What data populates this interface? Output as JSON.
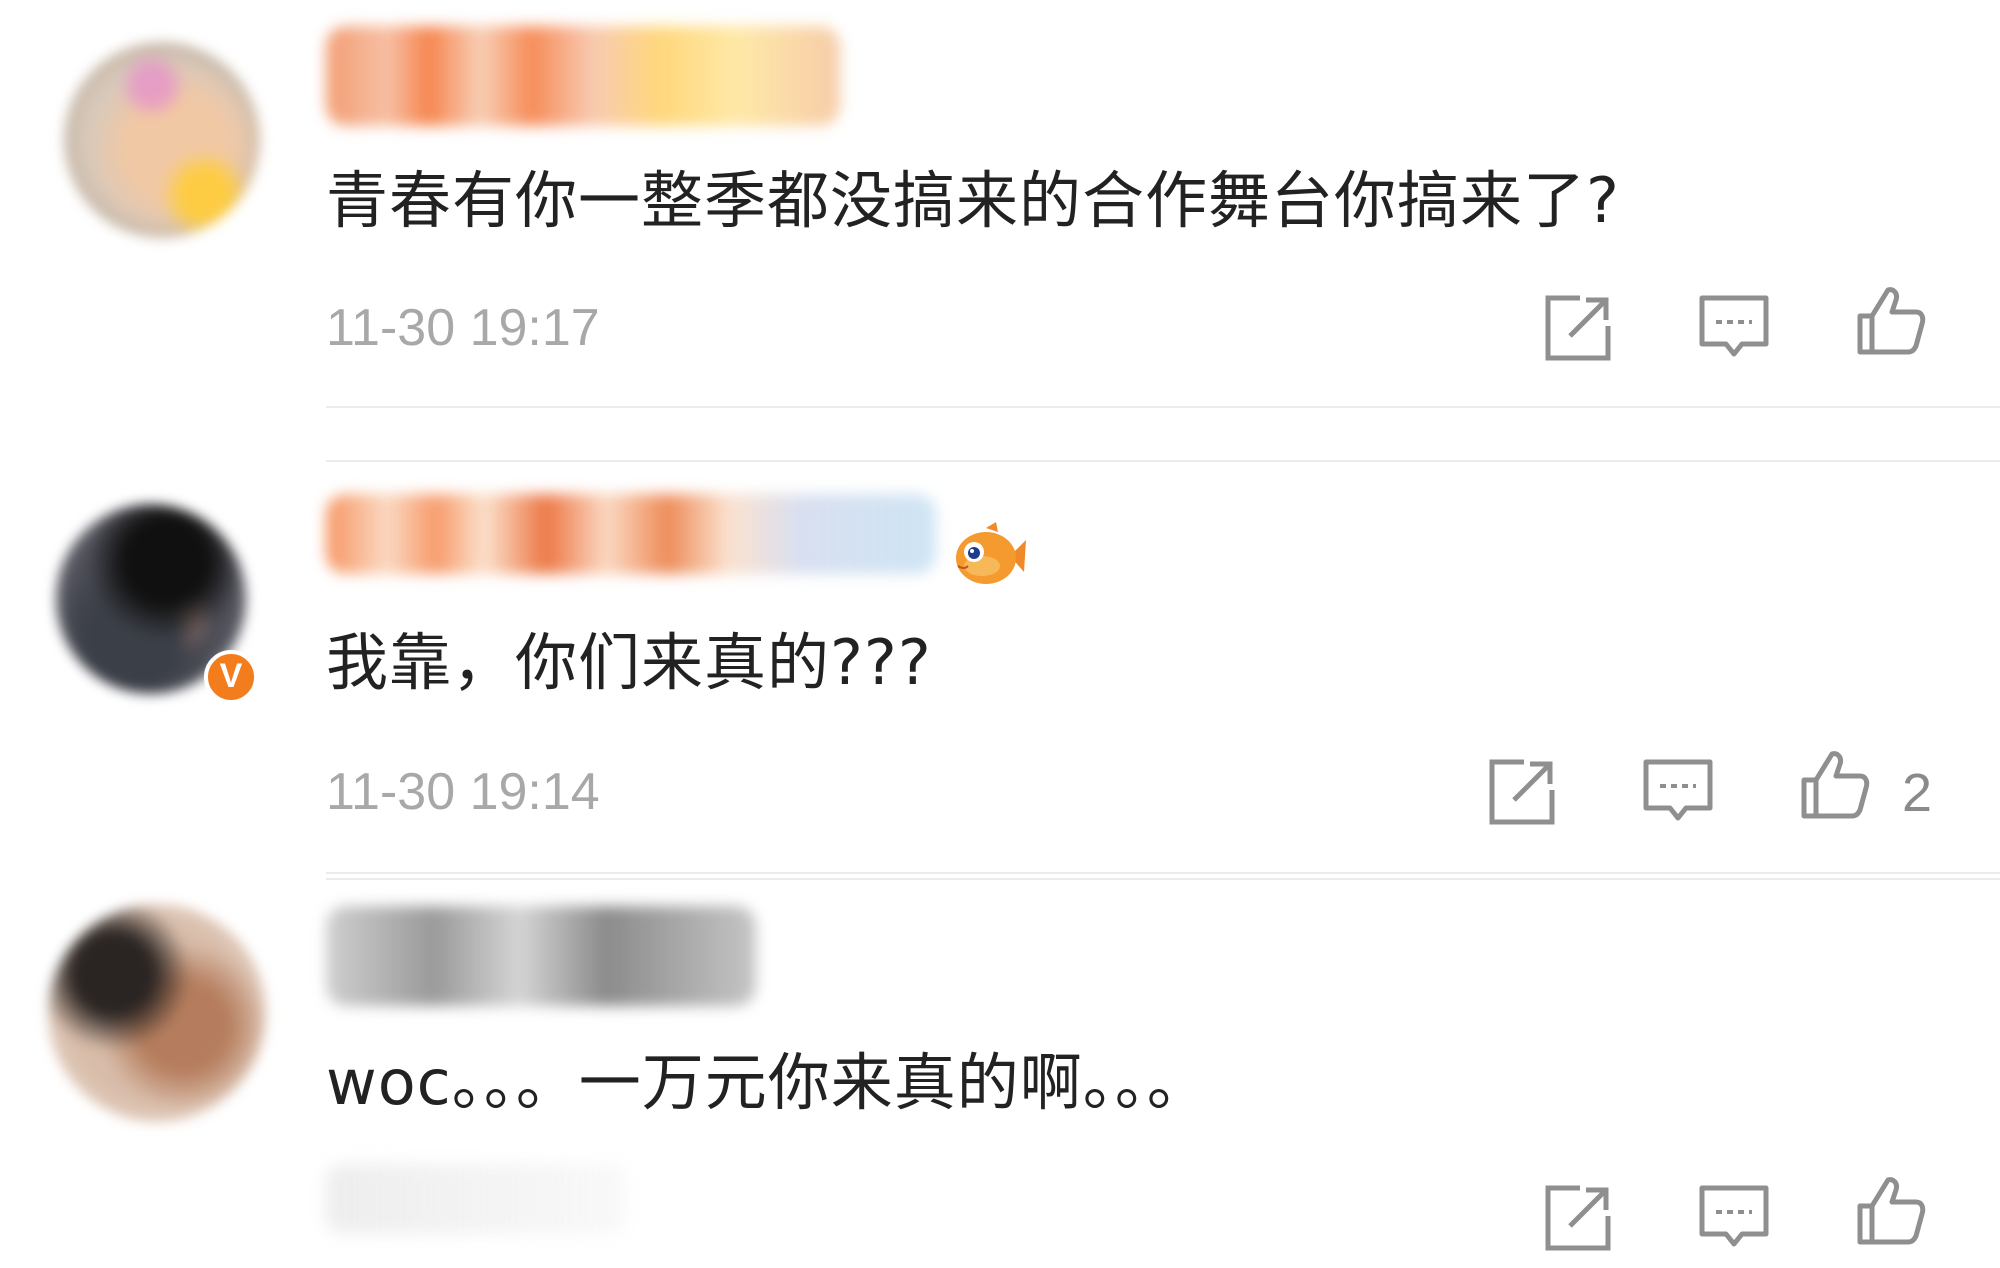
{
  "comments": [
    {
      "text": "青春有你一整季都没搞来的合作舞台你搞来了?",
      "time": "11-30 19:17",
      "likes": ""
    },
    {
      "text": "我靠，你们来真的???",
      "time": "11-30 19:14",
      "likes": "2",
      "verified_badge": "V"
    },
    {
      "text": "woc。。。一万元你来真的啊。。。",
      "time": "",
      "likes": ""
    }
  ],
  "colors": {
    "accent_verified": "#f37c1c",
    "text": "#222222",
    "meta": "#a8a8a8",
    "icon": "#8f8f8f"
  },
  "icons": {
    "share": "share-icon",
    "reply": "comment-icon",
    "like": "thumbs-up-icon",
    "emoji": "fish-emoji-icon"
  }
}
